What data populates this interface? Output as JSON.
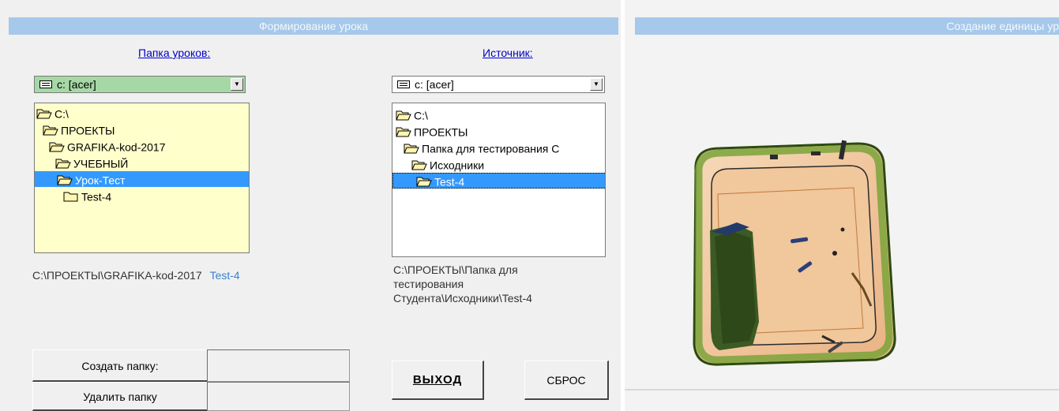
{
  "left_panel": {
    "title": "Формирование урока",
    "lessons_folder_label": "Папка уроков:",
    "source_label": "Источник:",
    "lessons_drive": "c: [acer]",
    "source_drive": "c: [acer]",
    "lessons_tree": [
      {
        "label": "C:\\",
        "selected": false
      },
      {
        "label": "ПРОЕКТЫ",
        "selected": false
      },
      {
        "label": "GRAFIKA-kod-2017",
        "selected": false
      },
      {
        "label": "УЧЕБНЫЙ",
        "selected": false
      },
      {
        "label": "Урок-Тест",
        "selected": true
      },
      {
        "label": "Test-4",
        "selected": false
      }
    ],
    "source_tree": [
      {
        "label": "C:\\",
        "selected": false
      },
      {
        "label": "ПРОЕКТЫ",
        "selected": false
      },
      {
        "label": "Папка для тестирования С",
        "selected": false
      },
      {
        "label": "Исходники",
        "selected": false
      },
      {
        "label": "Test-4",
        "selected": true
      }
    ],
    "lessons_path": "C:\\ПРОЕКТЫ\\GRAFIKA-kod-2017",
    "lessons_path_suffix": "Test-4",
    "source_path_lines": [
      "C:\\ПРОЕКТЫ\\Папка для",
      "тестирования",
      "Студента\\Исходники\\Test-4"
    ],
    "create_folder_label": "Создать папку:",
    "delete_folder_label": "Удалить папку",
    "create_folder_value": "",
    "delete_folder_value": "",
    "exit_label": "ВЫХОД",
    "reset_label": "СБРОС"
  },
  "right_panel": {
    "title": "Создание единицы ур"
  },
  "colors": {
    "title_bar": "#a6c8ea",
    "link": "#0000c8",
    "selection": "#3399ff",
    "tree_background": "#ffffcc",
    "combo_highlight": "#a6d8a6",
    "path_suffix": "#3a7fd0"
  },
  "icons": {
    "drive": "drive-icon",
    "folder": "folder-icon",
    "combo_arrow": "chevron-down-icon"
  }
}
